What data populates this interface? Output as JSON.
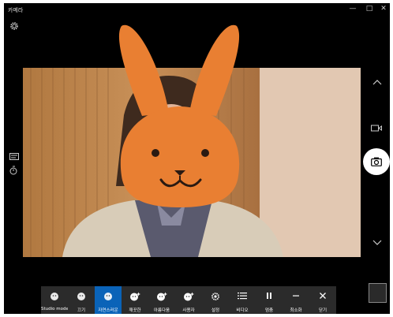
{
  "window": {
    "title": "카메라",
    "minimize_glyph": "—",
    "maximize_glyph": "□",
    "close_glyph": "✕"
  },
  "left_icons": [
    "settings-icon",
    "hdr-icon",
    "timer-icon"
  ],
  "right_controls": [
    "chevron-up-icon",
    "video-mode-icon",
    "photo-shutter-icon",
    "chevron-down-icon"
  ],
  "toolbar": {
    "items": [
      {
        "label": "Studio mode",
        "icon": "circle-icon"
      },
      {
        "label": "끄기",
        "icon": "circle-icon"
      },
      {
        "label": "자연스러운",
        "icon": "circle-icon",
        "active": true
      },
      {
        "label": "깨끗한",
        "icon": "sparkle-circle-icon"
      },
      {
        "label": "아름다움",
        "icon": "sparkle-circle-icon"
      },
      {
        "label": "사용자",
        "icon": "sparkle-circle-icon"
      },
      {
        "label": "설정",
        "icon": "gear-icon"
      },
      {
        "label": "비디오",
        "icon": "list-icon"
      },
      {
        "label": "멈춤",
        "icon": "pause-icon"
      },
      {
        "label": "최소화",
        "icon": "minimize-icon"
      },
      {
        "label": "닫기",
        "icon": "close-icon"
      }
    ]
  },
  "colors": {
    "background": "#000000",
    "toolbar": "#2b2b2b",
    "accent": "#0a63b8",
    "rabbit": "#e97f32"
  }
}
